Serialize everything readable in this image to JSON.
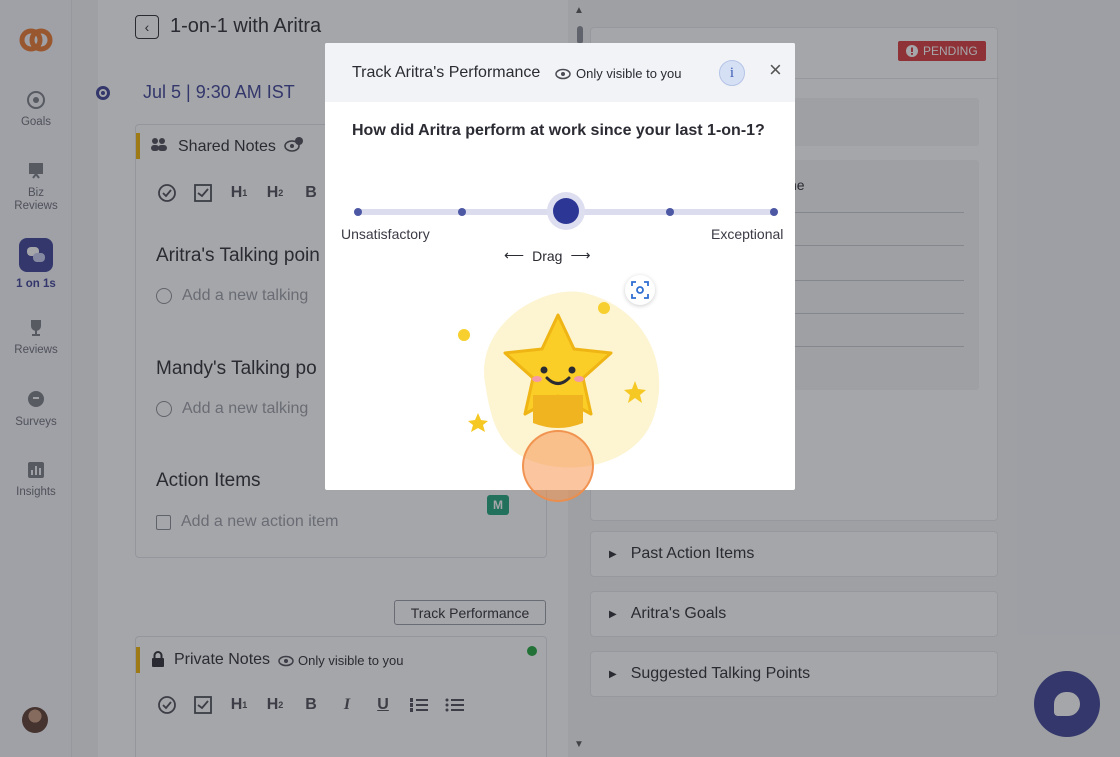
{
  "sidebar": {
    "items": [
      {
        "label": "Goals",
        "icon": "target-icon"
      },
      {
        "label": "Biz\nReviews",
        "line1": "Biz",
        "line2": "Reviews",
        "icon": "presentation-icon"
      },
      {
        "label": "1 on 1s",
        "icon": "chat-bubbles-icon",
        "active": true
      },
      {
        "label": "Reviews",
        "icon": "trophy-icon"
      },
      {
        "label": "Surveys",
        "icon": "survey-bubble-icon"
      },
      {
        "label": "Insights",
        "icon": "bar-chart-icon"
      }
    ]
  },
  "header": {
    "title": "1-on-1 with Aritra",
    "date": "Jul 5 | 9:30 AM IST"
  },
  "shared_notes": {
    "title": "Shared Notes",
    "aritra_points": "Aritra's Talking poin",
    "add_talking_1": "Add a new talking",
    "mandy_points": "Mandy's Talking po",
    "add_talking_2": "Add a new talking",
    "action_items": "Action Items",
    "add_action": "Add a new action item",
    "assignee_badge": "M"
  },
  "track_button": "Track Performance",
  "private_notes": {
    "title": "Private Notes",
    "visibility": "Only visible to you"
  },
  "right": {
    "status": "PENDING",
    "partial_text": "ne",
    "accordions": [
      "Past Action Items",
      "Aritra's Goals",
      "Suggested Talking Points"
    ]
  },
  "modal": {
    "title": "Track Aritra's Performance",
    "visibility": "Only visible to you",
    "info_label": "i",
    "close_label": "×",
    "question": "How did Aritra perform at work since your last 1-on-1?",
    "scale_min_label": "Unsatisfactory",
    "scale_max_label": "Exceptional",
    "drag_label": "Drag",
    "rating_steps": 5,
    "selected_step": 3
  },
  "colors": {
    "brand": "#3b4194",
    "pending": "#d8373d",
    "accent_yellow": "#f2b400"
  }
}
